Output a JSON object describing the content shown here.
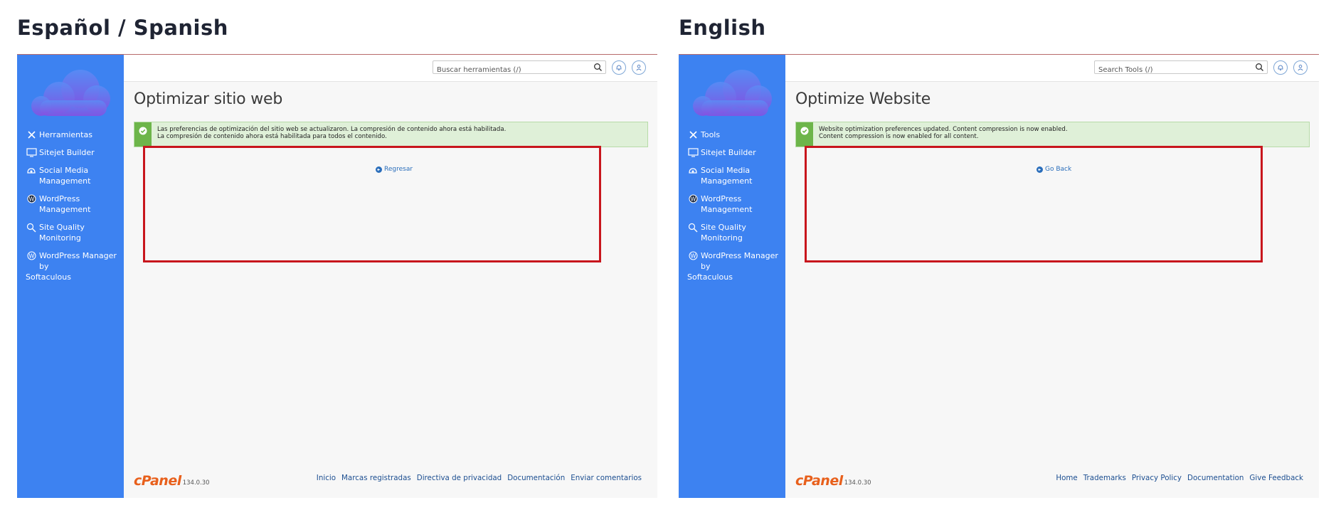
{
  "panels": [
    {
      "title": "Español / Spanish",
      "search_placeholder": "Buscar herramientas (/)",
      "nav": [
        {
          "icon": "tools-icon",
          "label": "Herramientas"
        },
        {
          "icon": "sitejet-icon",
          "label": "Sitejet Builder"
        },
        {
          "icon": "social-media-icon",
          "label": "Social Media Management"
        },
        {
          "icon": "wordpress-icon",
          "label": "WordPress Management"
        },
        {
          "icon": "site-quality-icon",
          "label": "Site Quality Monitoring"
        },
        {
          "icon": "wordpress-icon",
          "label": "WordPress Manager by",
          "tail": "Softaculous"
        }
      ],
      "page_title": "Optimizar sitio web",
      "alert_line1": "Las preferencias de optimización del sitio web se actualizaron. La compresión de contenido ahora está habilitada.",
      "alert_line2": "La compresión de contenido ahora está habilitada para todos el contenido.",
      "go_back": "Regresar",
      "brand": "cPanel",
      "version": "134.0.30",
      "footer_links": [
        "Inicio",
        "Marcas registradas",
        "Directiva de privacidad",
        "Documentación",
        "Enviar comentarios"
      ]
    },
    {
      "title": "English",
      "search_placeholder": "Search Tools (/)",
      "nav": [
        {
          "icon": "tools-icon",
          "label": "Tools"
        },
        {
          "icon": "sitejet-icon",
          "label": "Sitejet Builder"
        },
        {
          "icon": "social-media-icon",
          "label": "Social Media Management"
        },
        {
          "icon": "wordpress-icon",
          "label": "WordPress Management"
        },
        {
          "icon": "site-quality-icon",
          "label": "Site Quality Monitoring"
        },
        {
          "icon": "wordpress-icon",
          "label": "WordPress Manager by",
          "tail": "Softaculous"
        }
      ],
      "page_title": "Optimize Website",
      "alert_line1": "Website optimization preferences updated. Content compression is now enabled.",
      "alert_line2": "Content compression is now enabled for all content.",
      "go_back": "Go Back",
      "brand": "cPanel",
      "version": "134.0.30",
      "footer_links": [
        "Home",
        "Trademarks",
        "Privacy Policy",
        "Documentation",
        "Give Feedback"
      ]
    }
  ],
  "colors": {
    "sidebar": "#3d82f1",
    "alert_bg": "#dff0d8",
    "alert_bar": "#6db54a",
    "highlight_border": "#c8161d",
    "brand_orange": "#e8601c",
    "link": "#1d4f91"
  }
}
